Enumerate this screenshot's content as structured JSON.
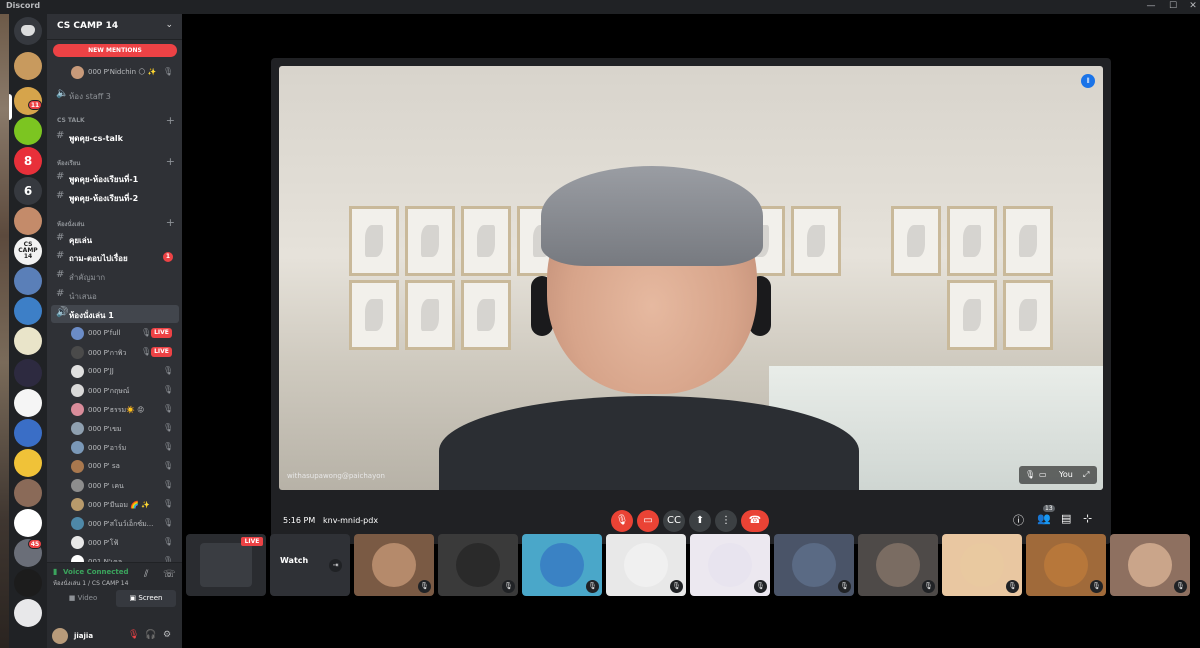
{
  "app": {
    "title": "Discord",
    "window_controls": [
      "—",
      "☐",
      "✕"
    ]
  },
  "guilds": {
    "badges": [
      "11",
      "45"
    ],
    "items": [
      {
        "icon": "discord-home-icon",
        "color": "#36393f",
        "text": ""
      },
      {
        "icon": "server-avatar",
        "color": "#c89a5e",
        "text": ""
      },
      {
        "icon": "server-avatar",
        "color": "#d6a44b",
        "text": ""
      },
      {
        "icon": "server-avatar",
        "color": "#7cc521",
        "text": ""
      },
      {
        "icon": "server-avatar",
        "color": "#e8303a",
        "text": "8"
      },
      {
        "icon": "server-avatar",
        "color": "#36393f",
        "text": "6"
      },
      {
        "icon": "server-avatar",
        "color": "#c48b6a",
        "text": ""
      },
      {
        "icon": "server-avatar",
        "color": "#f2f2f2",
        "text": "CS CAMP 14"
      },
      {
        "icon": "server-avatar",
        "color": "#5a7fb8",
        "text": ""
      },
      {
        "icon": "server-avatar",
        "color": "#3d7fc7",
        "text": ""
      },
      {
        "icon": "server-avatar",
        "color": "#e9e4c9",
        "text": ""
      },
      {
        "icon": "server-avatar",
        "color": "#2d2a40",
        "text": ""
      },
      {
        "icon": "server-avatar",
        "color": "#f5f5f5",
        "text": ""
      },
      {
        "icon": "server-avatar",
        "color": "#3a6ec6",
        "text": ""
      },
      {
        "icon": "server-avatar",
        "color": "#f0c238",
        "text": ""
      },
      {
        "icon": "server-avatar",
        "color": "#8a6a58",
        "text": ""
      },
      {
        "icon": "server-avatar",
        "color": "#ffffff",
        "text": ""
      },
      {
        "icon": "server-avatar",
        "color": "#6a6e78",
        "text": ""
      },
      {
        "icon": "server-avatar",
        "color": "#1c1c1c",
        "text": ""
      },
      {
        "icon": "server-avatar",
        "color": "#e8e8ea",
        "text": ""
      }
    ]
  },
  "server": {
    "name": "CS CAMP 14",
    "new_mentions": "NEW MENTIONS",
    "top_user": "000 P'Nidchin 🌕 ✨",
    "channels": {
      "staff3": "ห้อง staff 3",
      "cat_cstalk": "CS TALK",
      "cstalk": "พูดคุย-cs-talk",
      "cat_room": "ห้องเรียน",
      "room1": "พูดคุย-ห้องเรียนที่-1",
      "room2": "พูดคุย-ห้องเรียนที่-2",
      "cat_play": "ห้องนั่งเล่น",
      "chat": "คุยเล่น",
      "qa": "ถาม-ตอบไปเรื่อย",
      "qa_badge": "1",
      "important": "สำคัญมาก",
      "suggest": "นำเสนอ",
      "voice1": "ห้องนั่งเล่น 1"
    },
    "voice_users": [
      {
        "name": "000 P'full",
        "live": "LIVE",
        "color": "#6b8cc7"
      },
      {
        "name": "000 P'กาพิว",
        "live": "LIVE",
        "color": "#4a4a4a"
      },
      {
        "name": "000 P'JJ",
        "live": "",
        "color": "#e0e0e0"
      },
      {
        "name": "000 P'กฤษณ์",
        "live": "",
        "color": "#d9d9d9"
      },
      {
        "name": "000 P'ธรรม☀️ 😡",
        "live": "",
        "color": "#d98c9a"
      },
      {
        "name": "000 P'เขม",
        "live": "",
        "color": "#8fa0b0"
      },
      {
        "name": "000 P'อาร์ม",
        "live": "",
        "color": "#7a98b8"
      },
      {
        "name": "000 P' sa",
        "live": "",
        "color": "#a9784e"
      },
      {
        "name": "000 P' เคน",
        "live": "",
        "color": "#8d8d8d"
      },
      {
        "name": "000 P'มีนอม 🌈 ✨",
        "live": "",
        "color": "#b89a6b"
      },
      {
        "name": "000 P'สโนว์เอ็กซ์ม...",
        "live": "",
        "color": "#4e88a8"
      },
      {
        "name": "000 P'โฟ้",
        "live": "",
        "color": "#e8e8e8"
      },
      {
        "name": "001 N'เคล",
        "live": "",
        "color": "#ffffff"
      }
    ],
    "voice_panel": {
      "status": "Voice Connected",
      "location": "ห้องนั่งเล่น 1 / CS CAMP 14",
      "video_btn": "Video",
      "screen_btn": "Screen"
    },
    "user": {
      "name": "jiajia"
    }
  },
  "meeting": {
    "time": "5:16 PM",
    "code": "knv-mnid-pdx",
    "caption": "withasupawong@paichayon",
    "self_label": "You",
    "people_count": "13",
    "colors": {
      "end_call": "#ea4335",
      "muted": "#ea4335",
      "neutral": "#3c4043"
    }
  },
  "tiles": {
    "live": "LIVE",
    "watch": "Watch",
    "avatars": [
      "#b58a6b",
      "#2a2a2a",
      "#3a82c4",
      "#f0f0f0",
      "#e8e4ef",
      "#5a6a84",
      "#7a6c62",
      "#e9c9a0",
      "#b7773a",
      "#caa58a"
    ]
  }
}
